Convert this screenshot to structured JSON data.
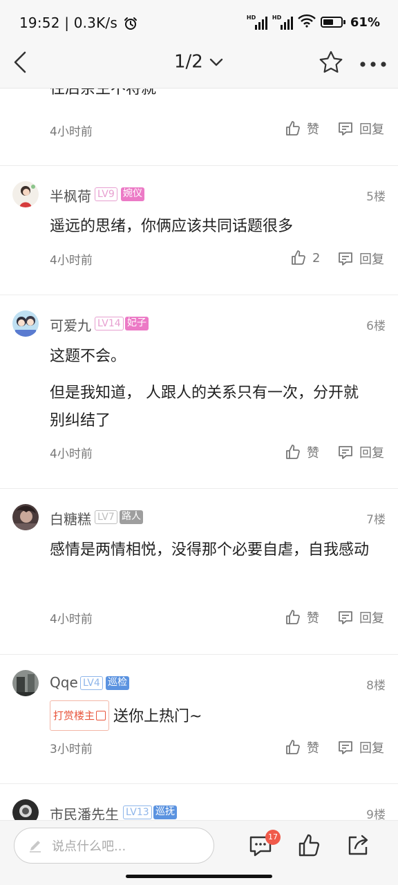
{
  "status_bar": {
    "time": "19:52",
    "speed": "0.3K/s",
    "network_1": "HD",
    "network_2": "HD",
    "battery": "61%"
  },
  "nav": {
    "page_indicator": "1/2"
  },
  "partial_comment_tail": "往后余生不将就",
  "top_reply": {
    "time": "4小时前",
    "like_label": "赞",
    "reply_label": "回复"
  },
  "comments": [
    {
      "username": "半枫荷",
      "level": "LV9",
      "role": "婉仪",
      "floor": "5楼",
      "text": "遥远的思绪，你俩应该共同话题很多",
      "time": "4小时前",
      "like_label": "2",
      "reply_label": "回复"
    },
    {
      "username": "可爱九",
      "level": "LV14",
      "role": "妃子",
      "floor": "6楼",
      "text": "这题不会。",
      "text2": "但是我知道， 人跟人的关系只有一次，分开就别纠结了",
      "time": "4小时前",
      "like_label": "赞",
      "reply_label": "回复"
    },
    {
      "username": "白糖糕",
      "level": "LV7",
      "role": "路人",
      "floor": "7楼",
      "text": "感情是两情相悦，没得那个必要自虐，自我感动",
      "time": "4小时前",
      "like_label": "赞",
      "reply_label": "回复"
    },
    {
      "username": "Qqe",
      "level": "LV4",
      "role": "巡检",
      "floor": "8楼",
      "tip_badge": "打赏楼主",
      "text": "送你上热门~",
      "time": "3小时前",
      "like_label": "赞",
      "reply_label": "回复"
    },
    {
      "username": "市民潘先生",
      "level": "LV13",
      "role": "巡抚",
      "floor": "9楼"
    }
  ],
  "bottom_bar": {
    "placeholder": "说点什么吧...",
    "comment_count": "17"
  },
  "colors": {
    "lv_pink": "#e79fd0",
    "role_pink": "#ec7ac6",
    "lv_gray": "#bdbdbd",
    "role_gray": "#9e9e9e",
    "lv_blue": "#8fb6ea",
    "role_blue": "#5b93e0",
    "tip_red": "#e8553c",
    "badge_red": "#f05a4a"
  }
}
